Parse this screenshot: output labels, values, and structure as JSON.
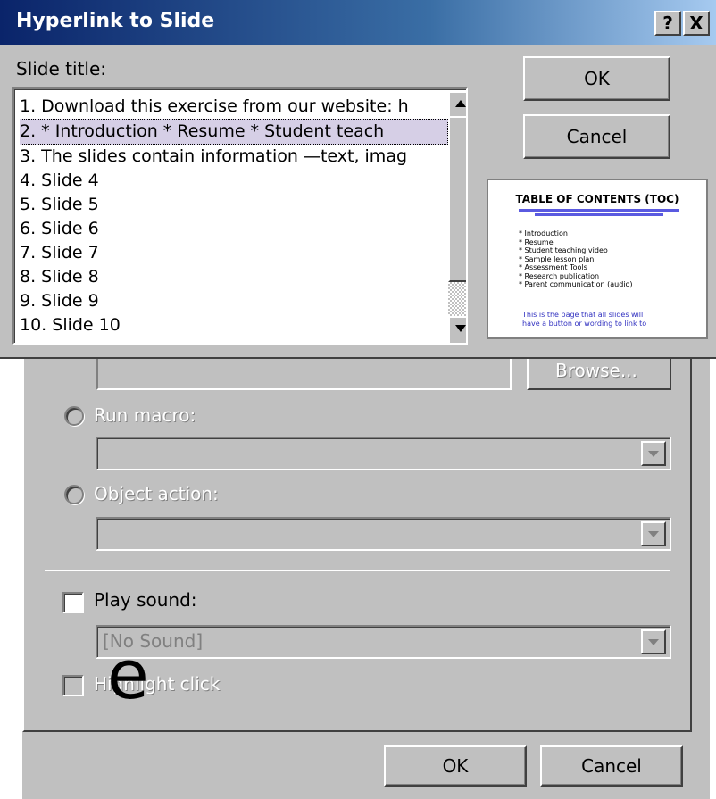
{
  "dialog": {
    "title": "Hyperlink to Slide",
    "title_buttons": [
      "?",
      "X"
    ],
    "slide_title_label": "Slide title:",
    "slides": [
      "1. Download this exercise from our website: h",
      "2. *  Introduction *  Resume *  Student teach",
      "3.  The slides contain information —text, imag",
      "4. Slide 4",
      "5. Slide 5",
      "6. Slide 6",
      "7. Slide 7",
      "8. Slide 8",
      "9. Slide 9",
      "10. Slide 10"
    ],
    "selected_index": 1,
    "ok_label": "OK",
    "cancel_label": "Cancel",
    "preview": {
      "title": "TABLE OF  CONTENTS (TOC)",
      "items": [
        "* Introduction",
        "* Resume",
        "* Student teaching video",
        "* Sample lesson plan",
        "* Assessment Tools",
        "* Research publication",
        "* Parent communication (audio)"
      ],
      "footer_line1": "This is the page that all slides will",
      "footer_line2": "have a button or wording to link to"
    }
  },
  "action_settings": {
    "browse_label": "Browse...",
    "run_macro_label": "Run macro:",
    "object_action_label": "Object action:",
    "play_sound_label": "Play sound:",
    "sound_value": "[No Sound]",
    "highlight_label": "Highlight click",
    "ok_label": "OK",
    "cancel_label": "Cancel"
  },
  "slide_fragment_letter": "e"
}
